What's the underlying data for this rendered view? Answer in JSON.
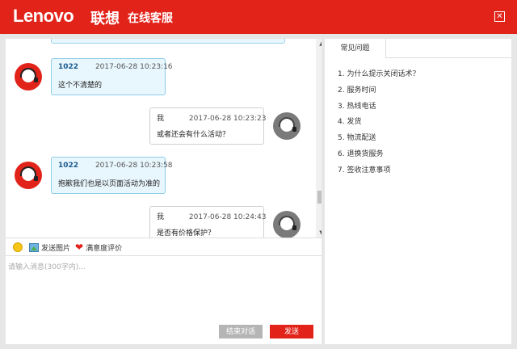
{
  "header": {
    "logo": "Lenovo",
    "logo_cn": "联想",
    "title": "在线客服",
    "close_glyph": "✕"
  },
  "colors": {
    "brand": "#e2231a",
    "agent_bubble": "#e8f6fd",
    "disabled_button": "#b5b5b5"
  },
  "chat": {
    "messages": [
      {
        "role": "agent",
        "sender": "1022",
        "time": "2017-06-28 10:23:16",
        "text": "这个不清楚的"
      },
      {
        "role": "user",
        "sender": "我",
        "time": "2017-06-28 10:23:23",
        "text": "或者还会有什么活动？"
      },
      {
        "role": "agent",
        "sender": "1022",
        "time": "2017-06-28 10:23:58",
        "text": "抱歉我们也是以页面活动为准的"
      },
      {
        "role": "user",
        "sender": "我",
        "time": "2017-06-28 10:24:43",
        "text": "是否有价格保护？"
      }
    ]
  },
  "toolbar": {
    "emoji_icon": "emoji-icon",
    "send_image_label": "发送图片",
    "rating_label": "满意度评价"
  },
  "input": {
    "placeholder": "请输入消息(300字内)..."
  },
  "buttons": {
    "end_chat": "结束对话",
    "send": "发送"
  },
  "faq": {
    "tab": "常见问题",
    "items": [
      "1. 为什么提示关闭话术？",
      "2. 服务时间",
      "3. 热线电话",
      "4. 发货",
      "5. 物流配送",
      "6. 退换货服务",
      "7. 签收注意事项"
    ]
  }
}
